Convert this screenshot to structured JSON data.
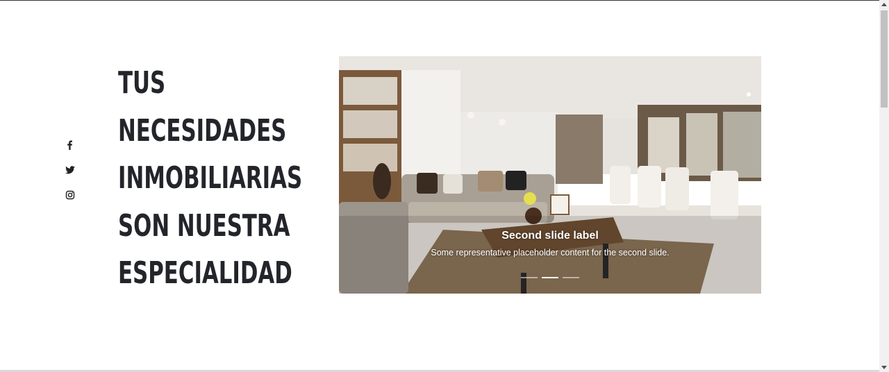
{
  "social": {
    "facebook": "facebook-icon",
    "twitter": "twitter-icon",
    "instagram": "instagram-icon"
  },
  "headline": {
    "lines": [
      "TUS",
      "NECESIDADES",
      "INMOBILIARIAS",
      "SON NUESTRA",
      "ESPECIALIDAD"
    ]
  },
  "carousel": {
    "slide_label": "Second slide label",
    "slide_text": "Some representative placeholder content for the second slide.",
    "indicators": 3,
    "active_indicator": 2
  }
}
